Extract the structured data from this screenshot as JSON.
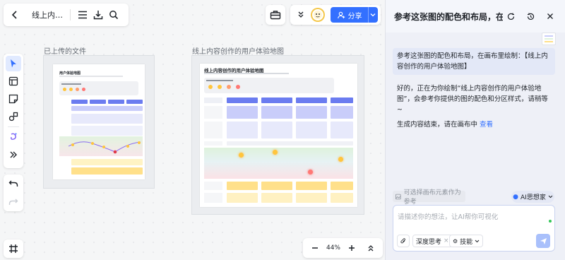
{
  "header": {
    "doc_title": "线上内…",
    "share_label": "分享"
  },
  "canvas": {
    "frames": [
      {
        "label": "已上传的文件",
        "doc_title": "用户体验地图"
      },
      {
        "label": "线上内容创作的用户体验地图",
        "doc_title": "线上内容创作的用户体验地图"
      }
    ],
    "zoom": "44%"
  },
  "panel": {
    "title": "参考这张图的配色和布局，在画…",
    "messages": [
      {
        "role": "user",
        "text": "参考这张图的配色和布局，在画布里绘制：【线上内容创作的用户体验地图】"
      },
      {
        "role": "ai",
        "text": "好的，正在为你绘制“线上内容创作的用户体验地图”，会参考你提供的图的配色和分区样式，请稍等~"
      },
      {
        "role": "ai",
        "text": "生成内容结束，请在画布中",
        "link": "查看"
      }
    ],
    "suggest_label": "可选择画布元素作为参考",
    "thinker_label": "AI思想家",
    "input_placeholder": "请描述你的想法，让AI帮你可视化",
    "deep_think_label": "深度思考",
    "skills_label": "技能"
  },
  "colors": {
    "accent": "#3370ff",
    "header_purple": "#6b7cf0",
    "pale_purple": "#c9cdfa",
    "pale_green": "#dff3df",
    "pale_pink": "#fbe3e6",
    "yellow": "#ffe08a"
  }
}
